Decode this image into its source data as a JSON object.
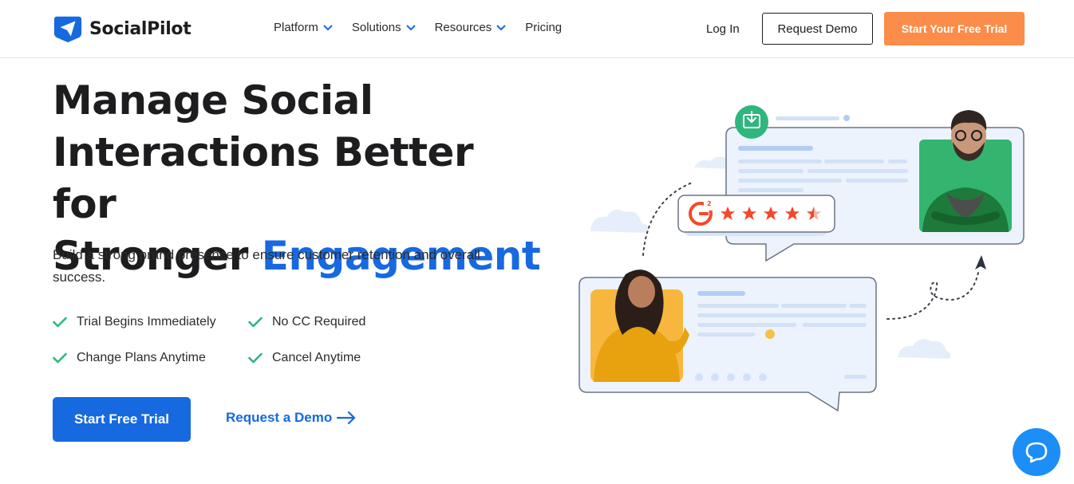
{
  "header": {
    "brand": "SocialPilot",
    "nav": [
      {
        "label": "Platform",
        "has_dropdown": true
      },
      {
        "label": "Solutions",
        "has_dropdown": true
      },
      {
        "label": "Resources",
        "has_dropdown": true
      },
      {
        "label": "Pricing",
        "has_dropdown": false
      }
    ],
    "login_label": "Log In",
    "request_demo_label": "Request Demo",
    "free_trial_label": "Start Your Free Trial"
  },
  "hero": {
    "title_line1": "Manage Social",
    "title_line2": "Interactions Better for",
    "title_line3_plain": "Stronger ",
    "title_line3_accent": "Engagement",
    "subtitle": "Build a strong brand presence to ensure customer retention and overall success.",
    "features": [
      "Trial Begins Immediately",
      "No CC Required",
      "Change Plans Anytime",
      "Cancel Anytime"
    ],
    "cta_primary": "Start Free Trial",
    "cta_secondary": "Request a Demo"
  },
  "illustration": {
    "badge_text": "G2",
    "rating_stars": 4.5
  },
  "colors": {
    "brand_blue": "#1769e0",
    "accent_orange": "#fb8c4a",
    "check_green": "#2fb67c",
    "star_red": "#f4482b"
  },
  "icons": {
    "logo": "paper-plane-icon",
    "chevron": "chevron-down-icon",
    "check": "check-icon",
    "arrow": "arrow-right-icon",
    "chat": "chat-bubble-icon"
  }
}
